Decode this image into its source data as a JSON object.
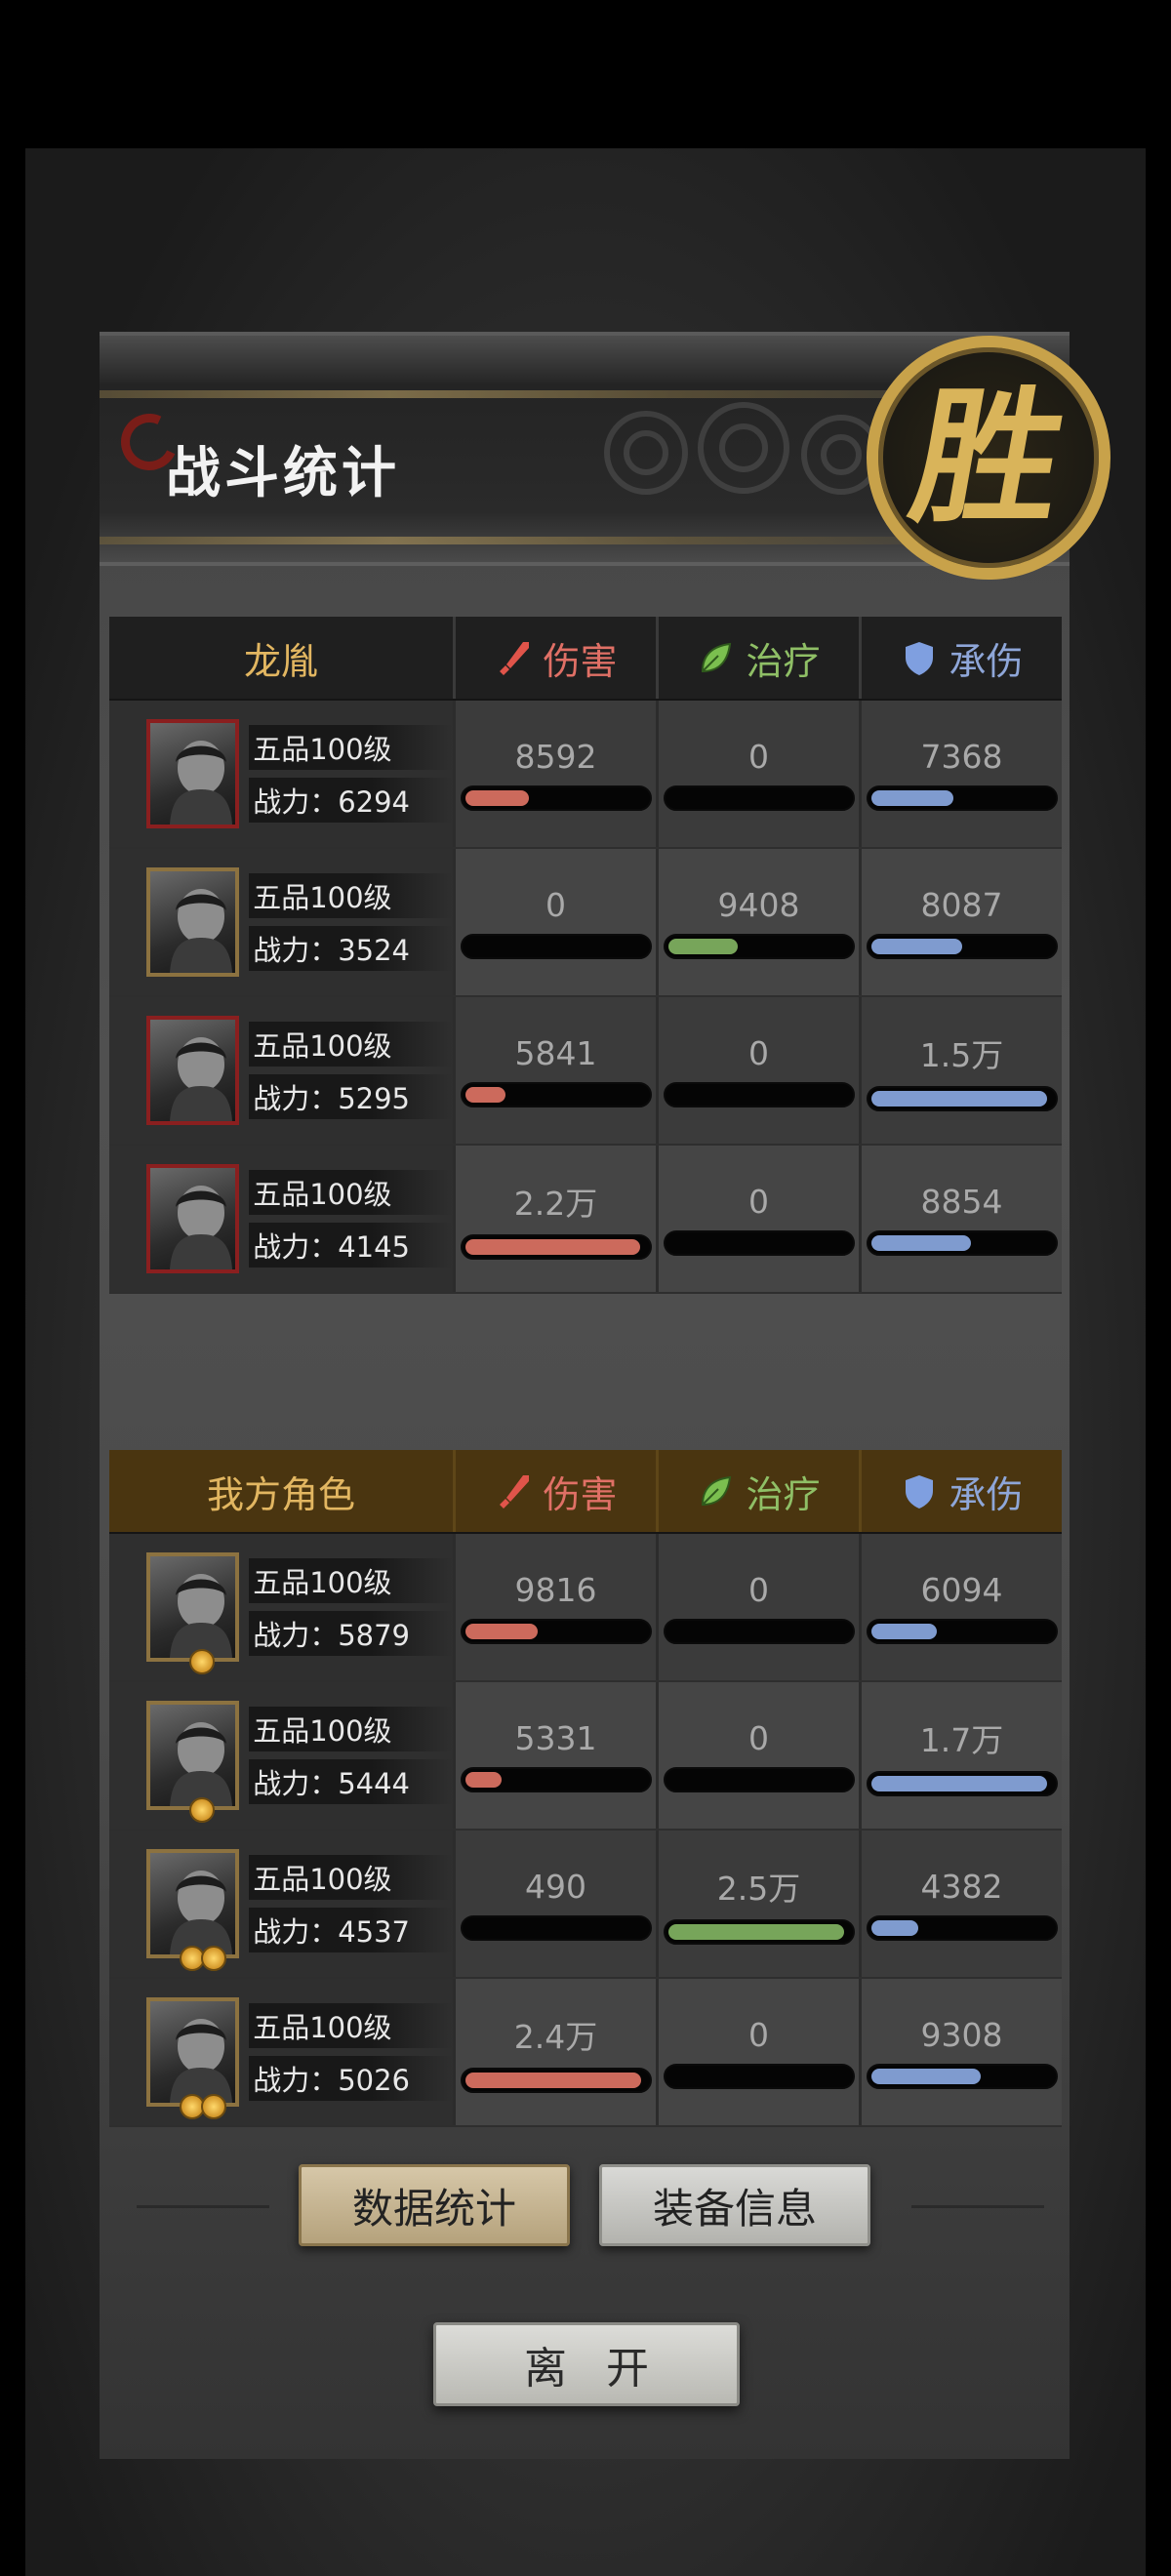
{
  "header": {
    "title": "战斗统计",
    "victory_badge": "胜"
  },
  "columns": {
    "damage": "伤害",
    "healing": "治疗",
    "damage_taken": "承伤"
  },
  "icons": {
    "damage": "sword-icon",
    "healing": "leaf-icon",
    "damage_taken": "shield-icon"
  },
  "colors": {
    "damage": "#cc6a5c",
    "healing": "#77a55a",
    "damage_taken": "#7f9bcf",
    "team_name": "#e2b661"
  },
  "enemy_team": {
    "name": "龙胤",
    "units": [
      {
        "rank": "五品100级",
        "power": "战力：6294",
        "damage": "8592",
        "healing": "0",
        "taken": "7368",
        "damage_fill": 0.35,
        "healing_fill": 0,
        "taken_fill": 0.45,
        "frame": "red"
      },
      {
        "rank": "五品100级",
        "power": "战力：3524",
        "damage": "0",
        "healing": "9408",
        "taken": "8087",
        "damage_fill": 0,
        "healing_fill": 0.38,
        "taken_fill": 0.5,
        "frame": "gold"
      },
      {
        "rank": "五品100级",
        "power": "战力：5295",
        "damage": "5841",
        "healing": "0",
        "taken": "1.5万",
        "damage_fill": 0.22,
        "healing_fill": 0,
        "taken_fill": 0.97,
        "frame": "red"
      },
      {
        "rank": "五品100级",
        "power": "战力：4145",
        "damage": "2.2万",
        "healing": "0",
        "taken": "8854",
        "damage_fill": 0.96,
        "healing_fill": 0,
        "taken_fill": 0.55,
        "frame": "red"
      }
    ]
  },
  "ally_team": {
    "name": "我方角色",
    "units": [
      {
        "rank": "五品100级",
        "power": "战力：5879",
        "damage": "9816",
        "healing": "0",
        "taken": "6094",
        "damage_fill": 0.4,
        "healing_fill": 0,
        "taken_fill": 0.36,
        "badges": 1
      },
      {
        "rank": "五品100级",
        "power": "战力：5444",
        "damage": "5331",
        "healing": "0",
        "taken": "1.7万",
        "damage_fill": 0.2,
        "healing_fill": 0,
        "taken_fill": 0.97,
        "badges": 1
      },
      {
        "rank": "五品100级",
        "power": "战力：4537",
        "damage": "490",
        "healing": "2.5万",
        "taken": "4382",
        "damage_fill": 0,
        "healing_fill": 0.97,
        "taken_fill": 0.26,
        "badges": 2
      },
      {
        "rank": "五品100级",
        "power": "战力：5026",
        "damage": "2.4万",
        "healing": "0",
        "taken": "9308",
        "damage_fill": 0.97,
        "healing_fill": 0,
        "taken_fill": 0.6,
        "badges": 2
      }
    ]
  },
  "tabs": {
    "active": "数据统计",
    "inactive": "装备信息"
  },
  "leave_button": "离开"
}
